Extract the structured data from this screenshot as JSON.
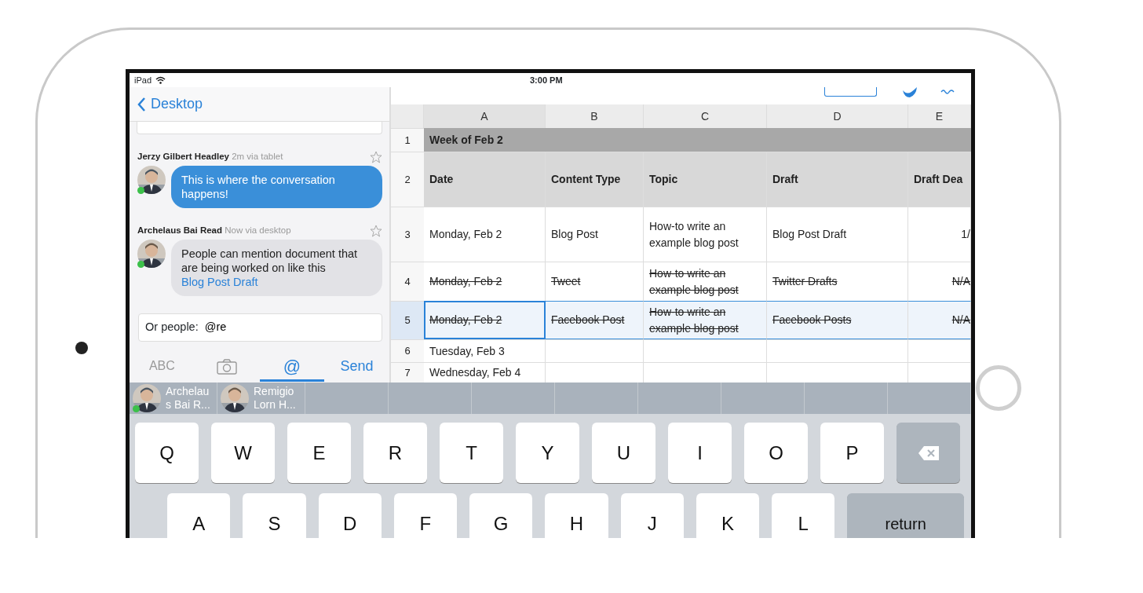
{
  "status_bar": {
    "device": "iPad",
    "time": "3:00 PM"
  },
  "chat": {
    "back": "Desktop",
    "messages": [
      {
        "author": "Jerzy Gilbert Headley",
        "meta": "2m via tablet",
        "kind": "highlight",
        "starred": false,
        "online": true,
        "text": "This is where the conversation happens!"
      },
      {
        "author": "Archelaus Bai Read",
        "meta": "Now via desktop",
        "kind": "plain",
        "starred": false,
        "online": true,
        "text": "People can mention document that are being worked on like this ",
        "link": "Blog Post Draft"
      }
    ],
    "compose": {
      "label": "Or people:",
      "value": "@re"
    },
    "tabs": [
      {
        "kind": "text",
        "label": "ABC",
        "selected": false
      },
      {
        "kind": "camera",
        "selected": false
      },
      {
        "kind": "text",
        "label": "@",
        "selected": true
      },
      {
        "kind": "action",
        "label": "Send",
        "selected": false
      }
    ]
  },
  "sheet": {
    "columns": [
      "A",
      "B",
      "C",
      "D",
      "E"
    ],
    "rows": [
      {
        "number": "1",
        "kind": "section",
        "cells": [
          "Week of Feb 2"
        ]
      },
      {
        "number": "2",
        "kind": "header",
        "cells": [
          "Date",
          "Content Type",
          "Topic",
          "Draft",
          "Draft Dea"
        ]
      },
      {
        "number": "3",
        "kind": "data",
        "struck": false,
        "selected": false,
        "cells": [
          "Monday, Feb 2",
          "Blog Post",
          "How-to write an example blog post",
          "Blog Post Draft",
          "1/"
        ]
      },
      {
        "number": "4",
        "kind": "data",
        "struck": true,
        "selected": false,
        "cells": [
          "Monday, Feb 2",
          "Tweet",
          "How-to write an example blog post",
          "Twitter Drafts",
          "N/A"
        ]
      },
      {
        "number": "5",
        "kind": "data",
        "struck": true,
        "selected": true,
        "cells": [
          "Monday, Feb 2",
          "Facebook Post",
          "How-to write an example blog post",
          "Facebook Posts",
          "N/A"
        ]
      },
      {
        "number": "6",
        "kind": "data",
        "struck": false,
        "selected": false,
        "cells": [
          "Tuesday, Feb 3",
          "",
          "",
          "",
          ""
        ]
      },
      {
        "number": "7",
        "kind": "data",
        "struck": false,
        "selected": false,
        "cells": [
          "Wednesday, Feb 4",
          "",
          "",
          "",
          ""
        ]
      }
    ]
  },
  "suggestions": [
    {
      "name": "Archelaus Bai R...",
      "online": true
    },
    {
      "name": "Remigio Lorn H...",
      "online": false
    }
  ],
  "keyboard": [
    [
      {
        "kind": "letter",
        "label": "Q"
      },
      {
        "kind": "letter",
        "label": "W"
      },
      {
        "kind": "letter",
        "label": "E"
      },
      {
        "kind": "letter",
        "label": "R"
      },
      {
        "kind": "letter",
        "label": "T"
      },
      {
        "kind": "letter",
        "label": "Y"
      },
      {
        "kind": "letter",
        "label": "U"
      },
      {
        "kind": "letter",
        "label": "I"
      },
      {
        "kind": "letter",
        "label": "O"
      },
      {
        "kind": "letter",
        "label": "P"
      },
      {
        "kind": "delete"
      }
    ],
    [
      {
        "kind": "letter",
        "label": "A"
      },
      {
        "kind": "letter",
        "label": "S"
      },
      {
        "kind": "letter",
        "label": "D"
      },
      {
        "kind": "letter",
        "label": "F"
      },
      {
        "kind": "letter",
        "label": "G"
      },
      {
        "kind": "letter",
        "label": "H"
      },
      {
        "kind": "letter",
        "label": "J"
      },
      {
        "kind": "letter",
        "label": "K"
      },
      {
        "kind": "letter",
        "label": "L"
      },
      {
        "kind": "return",
        "label": "return"
      }
    ]
  ]
}
